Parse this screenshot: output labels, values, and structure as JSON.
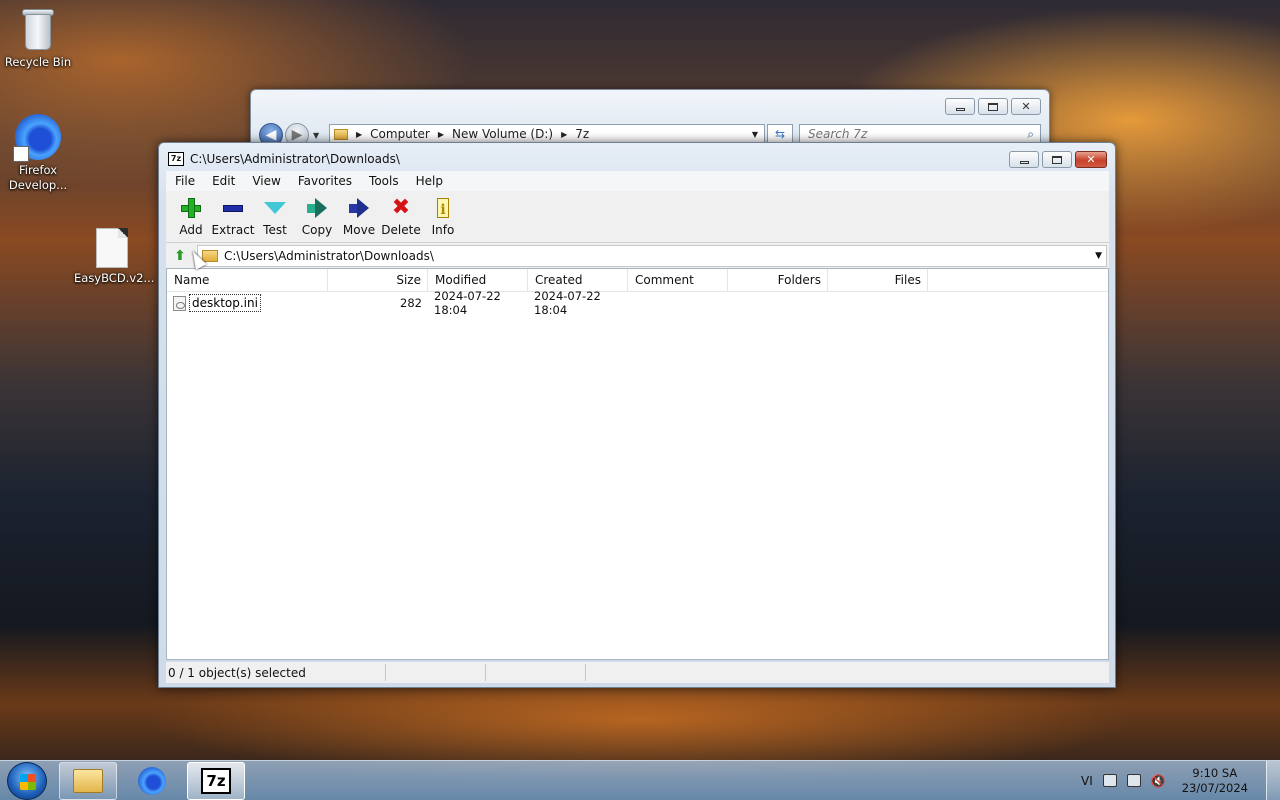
{
  "desktop": {
    "icons": [
      {
        "label": "Recycle Bin",
        "icon": "recycle-bin-icon"
      },
      {
        "label": "Firefox Develop...",
        "icon": "firefox-developer-icon"
      },
      {
        "label": "EasyBCD.v2...",
        "icon": "file-icon"
      }
    ]
  },
  "explorer": {
    "breadcrumb": [
      "Computer",
      "New Volume (D:)",
      "7z"
    ],
    "search_placeholder": "Search 7z"
  },
  "zip": {
    "title": "C:\\Users\\Administrator\\Downloads\\",
    "logo": "7z",
    "menu": [
      "File",
      "Edit",
      "View",
      "Favorites",
      "Tools",
      "Help"
    ],
    "toolbar": [
      {
        "label": "Add",
        "icon": "add-icon"
      },
      {
        "label": "Extract",
        "icon": "extract-icon"
      },
      {
        "label": "Test",
        "icon": "test-icon"
      },
      {
        "label": "Copy",
        "icon": "copy-icon"
      },
      {
        "label": "Move",
        "icon": "move-icon"
      },
      {
        "label": "Delete",
        "icon": "delete-icon"
      },
      {
        "label": "Info",
        "icon": "info-icon"
      }
    ],
    "path": "C:\\Users\\Administrator\\Downloads\\",
    "columns": [
      "Name",
      "Size",
      "Modified",
      "Created",
      "Comment",
      "Folders",
      "Files"
    ],
    "rows": [
      {
        "name": "desktop.ini",
        "size": "282",
        "modified": "2024-07-22 18:04",
        "created": "2024-07-22 18:04",
        "comment": "",
        "folders": "",
        "files": ""
      }
    ],
    "status": "0 / 1 object(s) selected"
  },
  "taskbar": {
    "apps": [
      "explorer-icon",
      "firefox-icon",
      "7zip-icon"
    ],
    "language": "VI",
    "time": "9:10 SA",
    "date": "23/07/2024"
  }
}
